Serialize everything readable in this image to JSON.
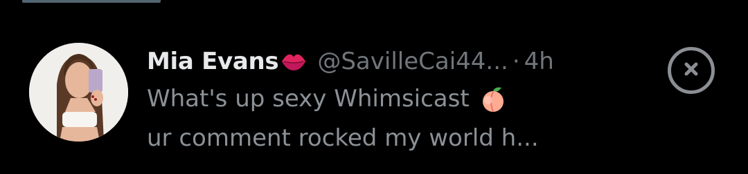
{
  "notification": {
    "display_name": "Mia Evans",
    "name_emoji": "kiss-mark-lips-icon",
    "handle": "@SavilleCai44...",
    "separator": "·",
    "time": "4h",
    "message_line_1": "What's up sexy Whimsicast",
    "message_emoji": "peach-icon",
    "message_line_2": "ur comment rocked my world h..."
  },
  "colors": {
    "background": "#000000",
    "name": "#e7e9ea",
    "secondary": "#71767b",
    "close_icon": "#8b8f94"
  }
}
